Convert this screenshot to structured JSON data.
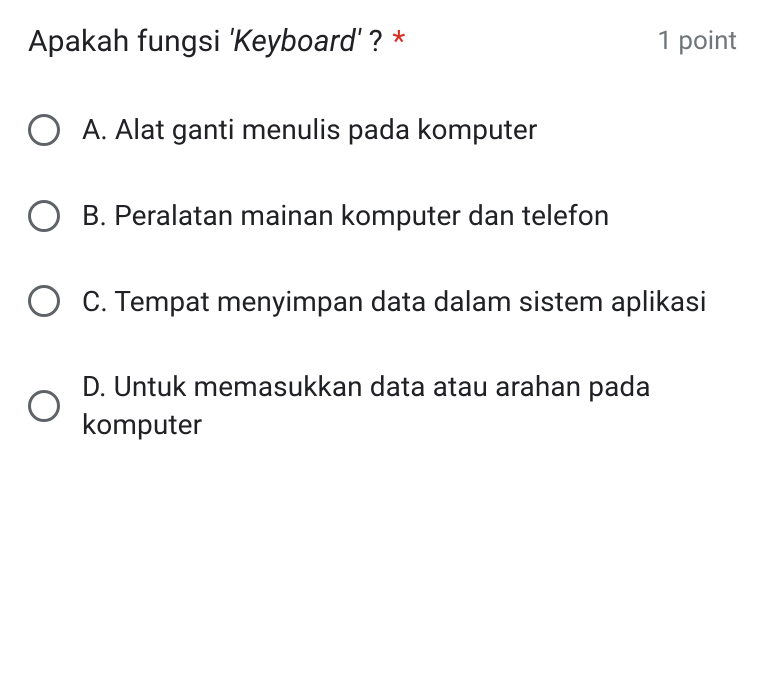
{
  "question": {
    "text_pre": "Apakah fungsi ",
    "text_italic": "'Keyboard'",
    "text_post": " ?",
    "required_mark": "*",
    "points_label": "1 point"
  },
  "options": [
    {
      "label": "A. Alat ganti menulis pada komputer"
    },
    {
      "label": "B. Peralatan mainan komputer  dan telefon"
    },
    {
      "label": "C. Tempat menyimpan data dalam sistem aplikasi"
    },
    {
      "label": "D. Untuk memasukkan data atau arahan pada komputer"
    }
  ]
}
